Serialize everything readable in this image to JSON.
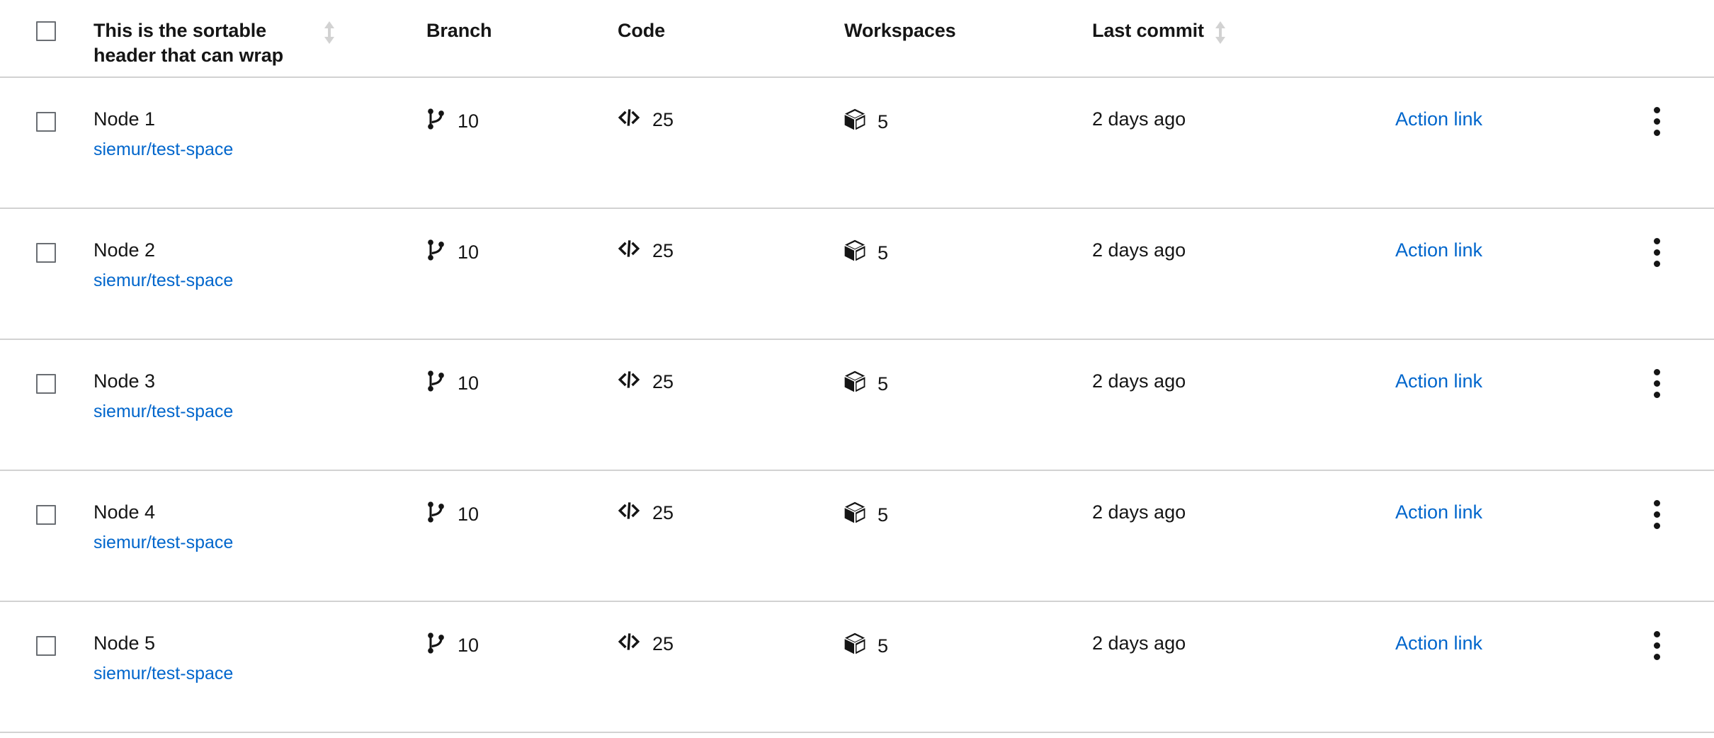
{
  "table": {
    "select_all_checkbox": "unchecked",
    "columns": [
      {
        "key": "select",
        "label": "",
        "sortable": false
      },
      {
        "key": "name",
        "label": "This is the sortable header that can wrap",
        "sortable": true
      },
      {
        "key": "branch",
        "label": "Branch",
        "sortable": false
      },
      {
        "key": "code",
        "label": "Code",
        "sortable": false
      },
      {
        "key": "workspaces",
        "label": "Workspaces",
        "sortable": false
      },
      {
        "key": "commit",
        "label": "Last commit",
        "sortable": true
      },
      {
        "key": "action",
        "label": "",
        "sortable": false
      },
      {
        "key": "kebab",
        "label": "",
        "sortable": false
      }
    ],
    "header": {
      "name_label": "This is the sortable header that can wrap",
      "branch_label": "Branch",
      "code_label": "Code",
      "workspaces_label": "Workspaces",
      "commit_label": "Last commit",
      "sort_icon": "sort-up-down-icon",
      "sort_state": "unsorted"
    },
    "icons": {
      "branch": "code-branch-icon",
      "code": "code-icon",
      "workspaces": "cube-icon",
      "kebab": "kebab-vertical-icon",
      "checkbox": "checkbox-unchecked-icon"
    },
    "rows": [
      {
        "checkbox": "unchecked",
        "name": "Node 1",
        "repo": "siemur/test-space",
        "branch": "10",
        "code": "25",
        "workspaces": "5",
        "commit": "2 days ago",
        "action": "Action link"
      },
      {
        "checkbox": "unchecked",
        "name": "Node 2",
        "repo": "siemur/test-space",
        "branch": "10",
        "code": "25",
        "workspaces": "5",
        "commit": "2 days ago",
        "action": "Action link"
      },
      {
        "checkbox": "unchecked",
        "name": "Node 3",
        "repo": "siemur/test-space",
        "branch": "10",
        "code": "25",
        "workspaces": "5",
        "commit": "2 days ago",
        "action": "Action link"
      },
      {
        "checkbox": "unchecked",
        "name": "Node 4",
        "repo": "siemur/test-space",
        "branch": "10",
        "code": "25",
        "workspaces": "5",
        "commit": "2 days ago",
        "action": "Action link"
      },
      {
        "checkbox": "unchecked",
        "name": "Node 5",
        "repo": "siemur/test-space",
        "branch": "10",
        "code": "25",
        "workspaces": "5",
        "commit": "2 days ago",
        "action": "Action link"
      }
    ]
  },
  "colors": {
    "text": "#151515",
    "link": "#0066cc",
    "border": "#d2d2d2",
    "checkbox_border": "#6a6e73",
    "sort_icon": "#d2d2d2",
    "background": "#ffffff"
  }
}
